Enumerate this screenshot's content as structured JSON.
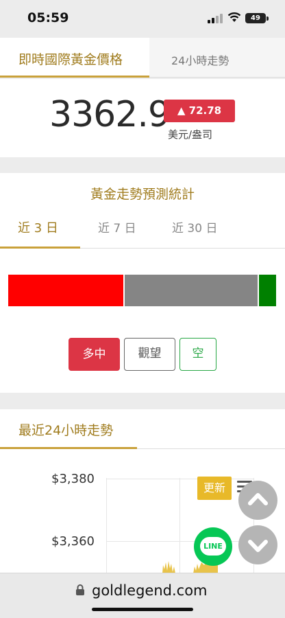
{
  "status_bar": {
    "time": "05:59",
    "battery": "49"
  },
  "price": {
    "tab_active": "即時國際黃金價格",
    "tab_other": "24小時走勢",
    "value": "3362.9",
    "change": "▲ 72.78",
    "unit": "美元/盎司",
    "change_color": "#dc3545"
  },
  "forecast": {
    "title": "黃金走勢預測統計",
    "tabs": [
      "近 3 日",
      "近 7 日",
      "近 30 日"
    ],
    "distribution": {
      "bullish": 0.43,
      "neutral": 0.5,
      "bearish": 0.07
    },
    "options": {
      "bullish": "多中",
      "neutral": "觀望",
      "bearish": "空"
    },
    "colors": {
      "bullish": "#ff0000",
      "neutral": "#858585",
      "bearish": "#008000"
    }
  },
  "trend": {
    "title": "最近24小時走勢",
    "y_ticks": [
      "$3,380",
      "$3,360"
    ],
    "update_label": "更新"
  },
  "line_button": {
    "label": "LINE"
  },
  "browser": {
    "url": "goldlegend.com"
  }
}
